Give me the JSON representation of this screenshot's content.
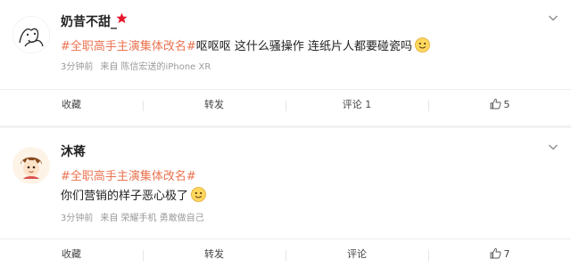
{
  "posts": [
    {
      "username": "奶昔不甜_",
      "topic": "#全职高手主演集体改名#",
      "text": "呕呕呕 这什么骚操作 连纸片人都要碰瓷吗",
      "time": "3分钟前",
      "source": "来自 陈信宏送的iPhone XR",
      "actions": {
        "favorite": "收藏",
        "repost": "转发",
        "comment": "评论 1",
        "like": "5"
      }
    },
    {
      "username": "沐蒋",
      "topic": "#全职高手主演集体改名#",
      "text": "你们营销的样子恶心极了",
      "time": "3分钟前",
      "source": "来自 荣耀手机 勇敢做自己",
      "actions": {
        "favorite": "收藏",
        "repost": "转发",
        "comment": "评论",
        "like": "7"
      }
    }
  ],
  "colors": {
    "topic": "#eb7350",
    "meta": "#999999",
    "divider": "#f2f2f2"
  },
  "icons": [
    "avatar-doodle",
    "vip-red-mark",
    "chevron-down-icon",
    "smile-emoji",
    "thumb-up-icon"
  ]
}
